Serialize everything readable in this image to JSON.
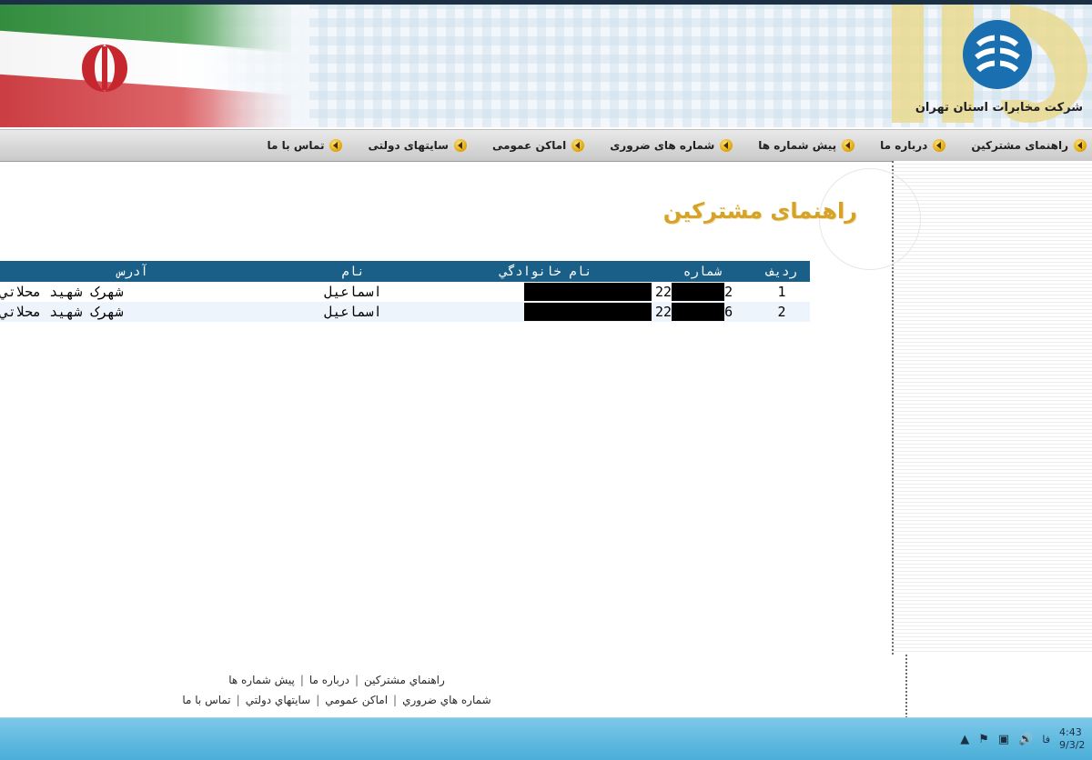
{
  "header": {
    "company_name": "شركت مخابرات استان تهران",
    "service_number": "118"
  },
  "nav": {
    "items": [
      {
        "label": "راهنماى مشتركين"
      },
      {
        "label": "درباره ما"
      },
      {
        "label": "پيش شماره ها"
      },
      {
        "label": "شماره هاى ضرورى"
      },
      {
        "label": "اماكن عمومى"
      },
      {
        "label": "سايتهاى دولتى"
      },
      {
        "label": "تماس با ما"
      }
    ]
  },
  "page": {
    "title": "راهنماى مشتركين"
  },
  "table": {
    "headers": {
      "row": "رديف",
      "number": "شماره",
      "family": "نام خانوادگي",
      "name": "نام",
      "address": "آدرس"
    },
    "rows": [
      {
        "row": "1",
        "num_prefix": "22",
        "num_suffix": "2",
        "name": "اسماعيل",
        "address": "شهرک شهيد محلاتي"
      },
      {
        "row": "2",
        "num_prefix": "22",
        "num_suffix": "6",
        "name": "اسماعيل",
        "address": "شهرک شهيد محلاتي"
      }
    ]
  },
  "footer": {
    "line1": [
      "راهنماي مشتركين",
      "درباره ما",
      "پيش شماره ها"
    ],
    "line2": [
      "شماره هاي ضروري",
      "اماكن عمومي",
      "سايتهاي دولتي",
      "تماس با ما"
    ],
    "separator": "|"
  },
  "taskbar": {
    "lang": "فا",
    "time": "4:43",
    "date": "9/3/2"
  }
}
